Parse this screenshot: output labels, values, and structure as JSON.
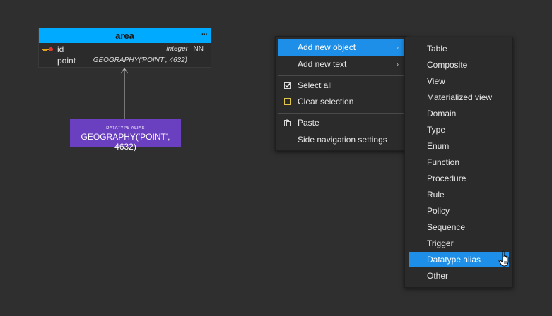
{
  "entity": {
    "title": "area",
    "menu_glyph": "···",
    "header_color": "#00aaff",
    "columns": [
      {
        "name": "id",
        "type": "integer",
        "constraint": "NN",
        "icon": "primary-key-icon"
      },
      {
        "name": "point",
        "type": "GEOGRAPHY('POINT', 4632)",
        "constraint": ""
      }
    ]
  },
  "alias": {
    "kind": "DATATYPE ALIAS",
    "value": "GEOGRAPHY('POINT', 4632)",
    "color": "#6a3fc0"
  },
  "context_menu": {
    "items": [
      {
        "label": "Add new object",
        "has_submenu": true,
        "active": true
      },
      {
        "label": "Add new text",
        "has_submenu": true
      },
      {
        "label": "Select all",
        "icon": "checked-checkbox-icon"
      },
      {
        "label": "Clear selection",
        "icon": "empty-checkbox-icon"
      },
      {
        "label": "Paste",
        "icon": "paste-icon"
      },
      {
        "label": "Side navigation settings"
      }
    ],
    "submenu_arrow": "›"
  },
  "submenu": {
    "items": [
      "Table",
      "Composite",
      "View",
      "Materialized view",
      "Domain",
      "Type",
      "Enum",
      "Function",
      "Procedure",
      "Rule",
      "Policy",
      "Sequence",
      "Trigger",
      "Datatype alias",
      "Other"
    ],
    "active_index": 13,
    "highlight_color": "#1d8fe8"
  }
}
